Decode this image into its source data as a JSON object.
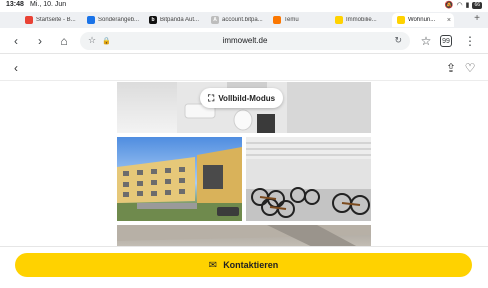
{
  "status_bar": {
    "time": "13:48",
    "date": "Mi., 10. Jun",
    "battery": "66",
    "icons": [
      "location-icon",
      "signal-icon",
      "wifi-icon",
      "mute-icon",
      "battery-icon"
    ]
  },
  "tabs": [
    {
      "label": "Startseite - B...",
      "favicon_color": "#e94235",
      "active": false
    },
    {
      "label": "Sonderangeb...",
      "favicon_color": "#1a73e8",
      "active": false
    },
    {
      "label": "Bitpanda Aut...",
      "favicon_color": "#111111",
      "favicon_letter": "b",
      "active": false
    },
    {
      "label": "account.bitpa...",
      "favicon_color": "#bdbdbd",
      "favicon_letter": "A",
      "active": false
    },
    {
      "label": "Temu",
      "favicon_color": "#fb7701",
      "active": false
    },
    {
      "label": "Immobilie...",
      "favicon_color": "#ffd200",
      "active": false
    },
    {
      "label": "Wohnun...",
      "favicon_color": "#ffd200",
      "active": true
    }
  ],
  "toolbar": {
    "url": "immowelt.de",
    "tab_count": "99"
  },
  "gallery": {
    "fullscreen_label": "Vollbild-Modus"
  },
  "cta": {
    "contact_label": "Kontaktieren",
    "accent": "#ffd200"
  }
}
